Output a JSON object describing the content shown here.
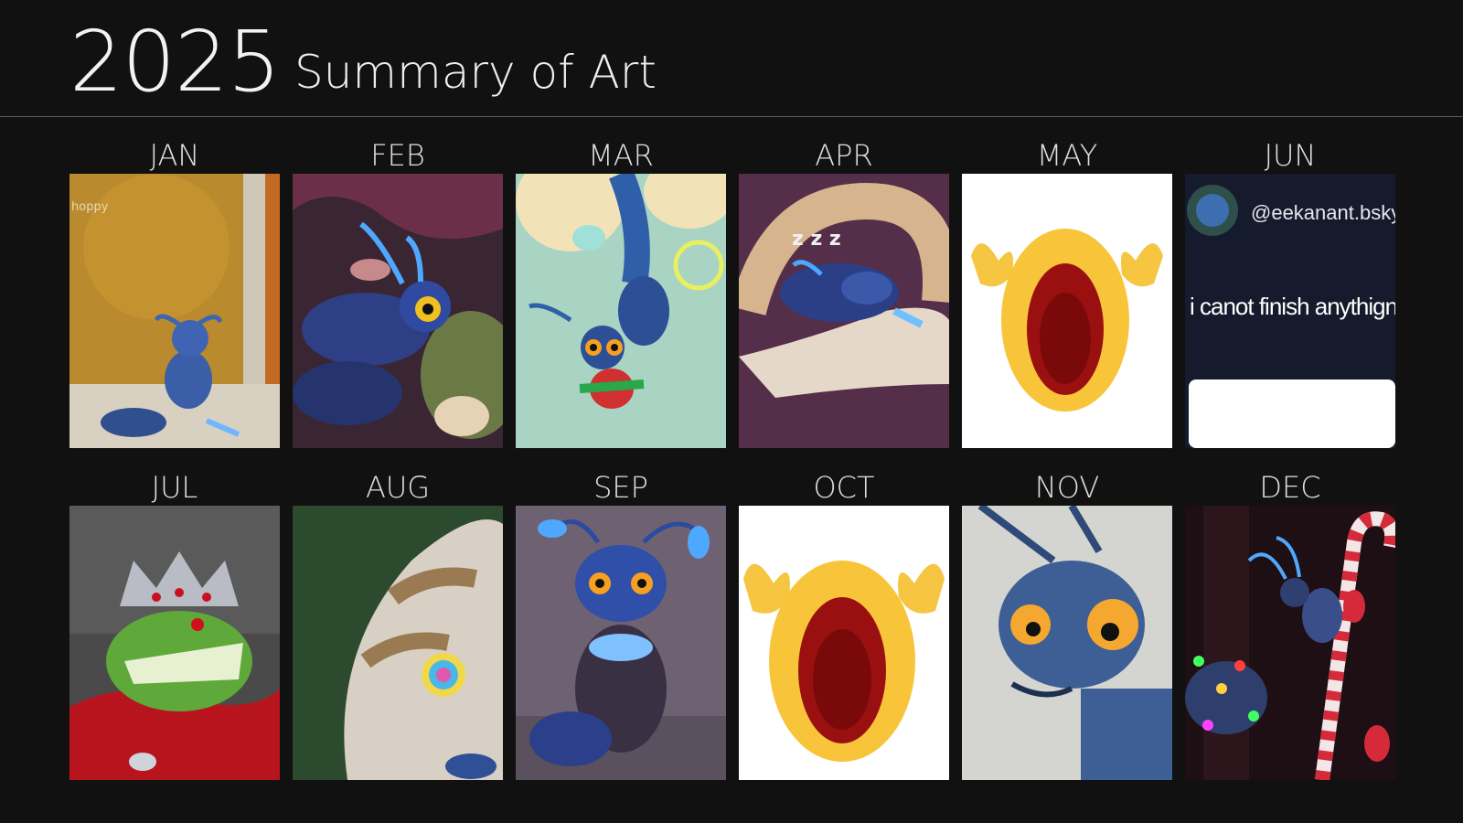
{
  "header": {
    "year": "2025",
    "subtitle": "Summary of Art"
  },
  "months": [
    {
      "label": "JAN",
      "art": "ant-by-window"
    },
    {
      "label": "FEB",
      "art": "ant-hugging-creature"
    },
    {
      "label": "MAR",
      "art": "ant-hanging-with-strawberry"
    },
    {
      "label": "APR",
      "art": "ant-sleeping-on-snake"
    },
    {
      "label": "MAY",
      "art": "crying-emoji"
    },
    {
      "label": "JUN",
      "art": "social-post-screenshot"
    },
    {
      "label": "JUL",
      "art": "crowned-crocodile"
    },
    {
      "label": "AUG",
      "art": "snake-closeup"
    },
    {
      "label": "SEP",
      "art": "ant-sitting"
    },
    {
      "label": "OCT",
      "art": "crying-emoji"
    },
    {
      "label": "NOV",
      "art": "ant-closeup"
    },
    {
      "label": "DEC",
      "art": "ant-on-candy-cane"
    }
  ],
  "june_post": {
    "handle": "@eekanant.bsky.s",
    "text": "i canot finish anythign"
  },
  "jan_snippet": "hoppy",
  "sleep_zs": "z z z"
}
